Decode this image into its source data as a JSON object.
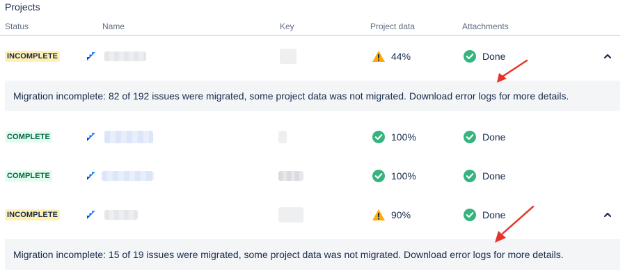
{
  "section": {
    "title": "Projects"
  },
  "columns": {
    "status": "Status",
    "name": "Name",
    "key": "Key",
    "project_data": "Project data",
    "attachments": "Attachments"
  },
  "rows": [
    {
      "status": "INCOMPLETE",
      "status_type": "incomplete",
      "project_data_pct": "44%",
      "project_data_icon": "warning-icon",
      "attachments": "Done",
      "attachments_icon": "check-circle-icon",
      "expanded": true,
      "message": "Migration incomplete: 82 of 192 issues were migrated, some project data was not migrated. Download error logs for more details."
    },
    {
      "status": "COMPLETE",
      "status_type": "complete",
      "project_data_pct": "100%",
      "project_data_icon": "check-circle-icon",
      "attachments": "Done",
      "attachments_icon": "check-circle-icon",
      "expanded": false
    },
    {
      "status": "COMPLETE",
      "status_type": "complete",
      "project_data_pct": "100%",
      "project_data_icon": "check-circle-icon",
      "attachments": "Done",
      "attachments_icon": "check-circle-icon",
      "expanded": false
    },
    {
      "status": "INCOMPLETE",
      "status_type": "incomplete",
      "project_data_pct": "90%",
      "project_data_icon": "warning-icon",
      "attachments": "Done",
      "attachments_icon": "check-circle-icon",
      "expanded": true,
      "message": "Migration incomplete: 15 of 19 issues were migrated, some project data was not migrated. Download error logs for more details."
    }
  ],
  "colors": {
    "success": "#36B37E",
    "warning": "#FFAB00",
    "jira_blue": "#2684FF",
    "annotation_arrow": "#E8332A"
  }
}
